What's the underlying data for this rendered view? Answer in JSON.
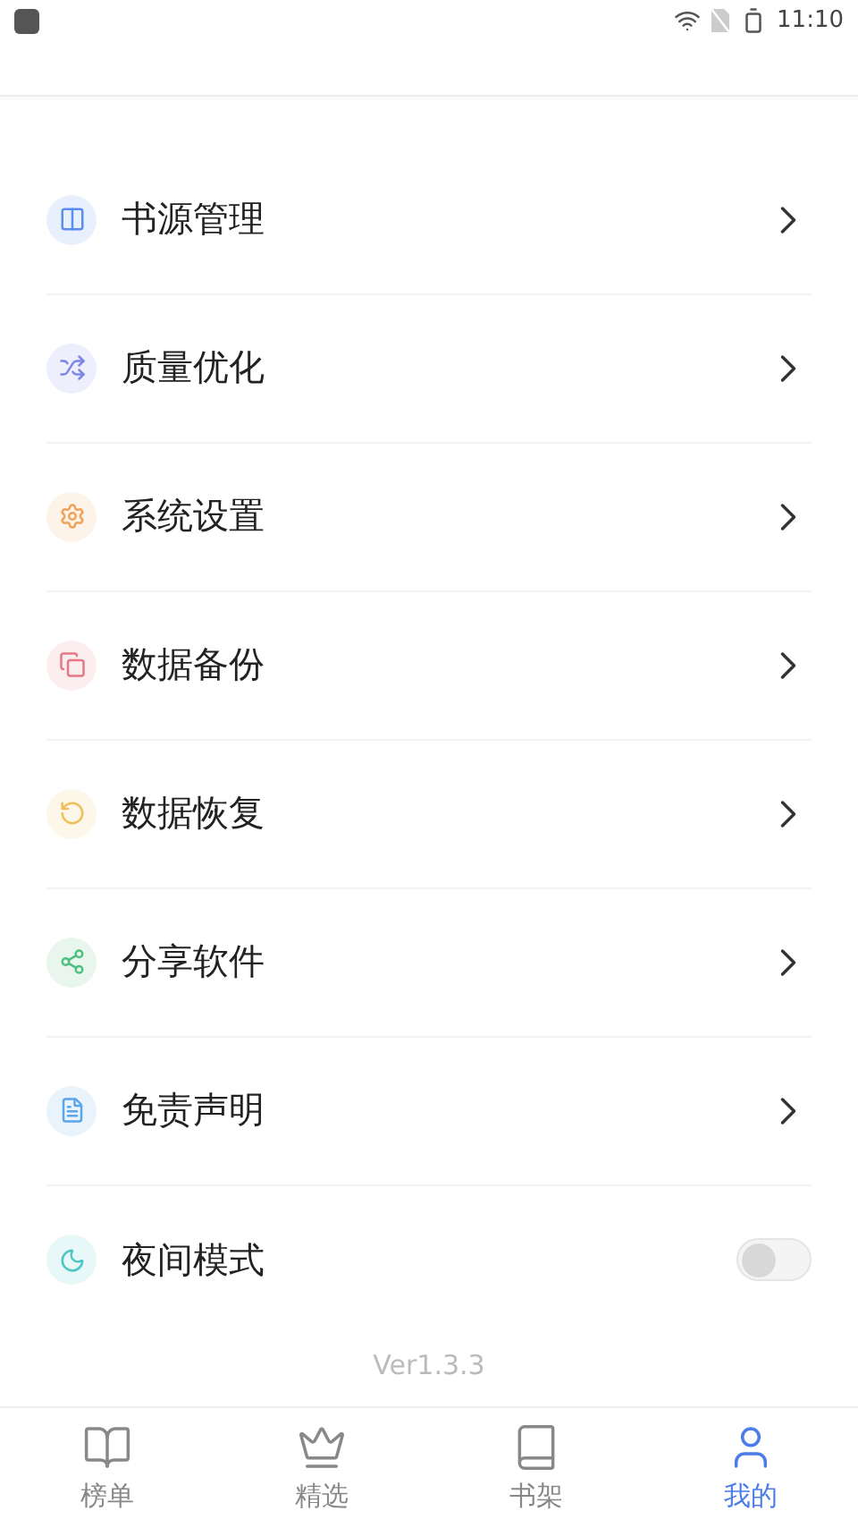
{
  "status_bar": {
    "time": "11:10"
  },
  "menu": [
    {
      "label": "书源管理",
      "kind": "link",
      "color": "#5b8def"
    },
    {
      "label": "质量优化",
      "kind": "link",
      "color": "#7b86e8"
    },
    {
      "label": "系统设置",
      "kind": "link",
      "color": "#f0a25a"
    },
    {
      "label": "数据备份",
      "kind": "link",
      "color": "#e57a86"
    },
    {
      "label": "数据恢复",
      "kind": "link",
      "color": "#efc05a"
    },
    {
      "label": "分享软件",
      "kind": "link",
      "color": "#4fbf7f"
    },
    {
      "label": "免责声明",
      "kind": "link",
      "color": "#5aa6e8"
    },
    {
      "label": "夜间模式",
      "kind": "toggle",
      "color": "#4fc6c6",
      "on": false
    }
  ],
  "version": "Ver1.3.3",
  "tabs": [
    {
      "label": "榜单",
      "selected": false
    },
    {
      "label": "精选",
      "selected": false
    },
    {
      "label": "书架",
      "selected": false
    },
    {
      "label": "我的",
      "selected": true
    }
  ]
}
